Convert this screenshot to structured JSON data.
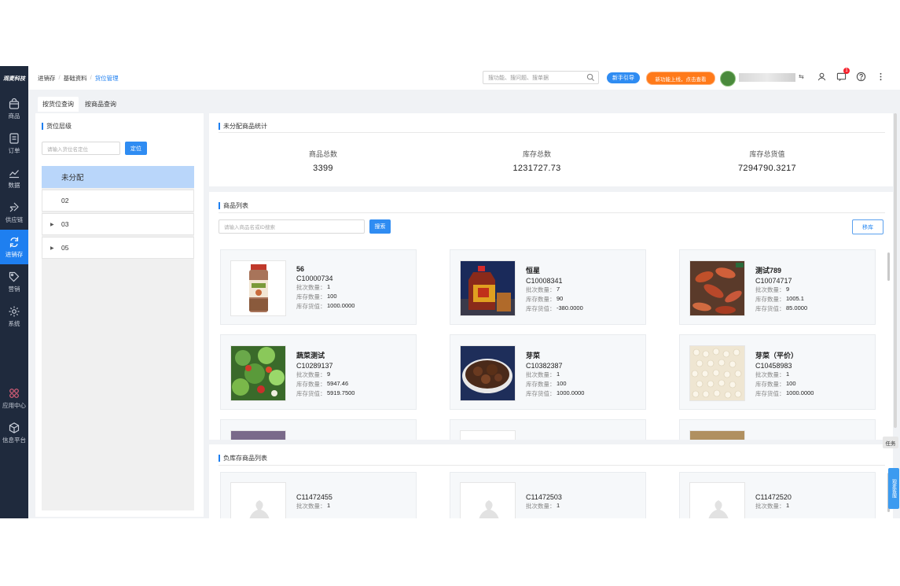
{
  "brand": "观麦科技",
  "sidebar": {
    "items": [
      {
        "label": "商品",
        "icon": "bag-icon"
      },
      {
        "label": "订单",
        "icon": "order-icon"
      },
      {
        "label": "数据",
        "icon": "chart-icon"
      },
      {
        "label": "供应链",
        "icon": "supply-chain-icon"
      },
      {
        "label": "进销存",
        "icon": "inventory-icon",
        "active": true
      },
      {
        "label": "营销",
        "icon": "tag-icon"
      },
      {
        "label": "系统",
        "icon": "gear-icon"
      }
    ],
    "bottom": [
      {
        "label": "应用中心",
        "icon": "app-center-icon"
      },
      {
        "label": "信息平台",
        "icon": "cube-icon"
      }
    ]
  },
  "breadcrumb": [
    "进销存",
    "基础资料",
    "货位管理"
  ],
  "topbar": {
    "search_placeholder": "搜功能、搜问题、搜单据",
    "guide_label": "新手引导",
    "promo_label": "新功能上线，点击查看",
    "notification_count": "1"
  },
  "tabs": [
    "按货位查询",
    "按商品查询"
  ],
  "left": {
    "title": "货位层级",
    "search_placeholder": "请输入货位名定位",
    "locate_label": "定位",
    "tree": [
      {
        "label": "未分配",
        "selected": true,
        "expandable": false
      },
      {
        "label": "02",
        "selected": false,
        "expandable": false
      },
      {
        "label": "03",
        "selected": false,
        "expandable": true
      },
      {
        "label": "05",
        "selected": false,
        "expandable": true
      }
    ]
  },
  "stats": {
    "title": "未分配商品统计",
    "items": [
      {
        "label": "商品总数",
        "value": "3399"
      },
      {
        "label": "库存总数",
        "value": "1231727.73"
      },
      {
        "label": "库存总货值",
        "value": "7294790.3217"
      }
    ]
  },
  "goods": {
    "title": "商品列表",
    "search_placeholder": "请输入商品名或ID搜索",
    "search_label": "搜索",
    "move_label": "移库",
    "labels": {
      "batch": "批次数量：",
      "stock": "库存数量：",
      "value": "库存货值："
    },
    "items": [
      {
        "name": "56",
        "code": "C10000734",
        "batch": "1",
        "stock": "100",
        "value": "1000.0000",
        "image": "spice-jar"
      },
      {
        "name": "恒星",
        "code": "C10008341",
        "batch": "7",
        "stock": "90",
        "value": "-380.0000",
        "image": "oil-bottle"
      },
      {
        "name": "测试789",
        "code": "C10074717",
        "batch": "9",
        "stock": "1005.1",
        "value": "85.0000",
        "image": "crayfish"
      },
      {
        "name": "蔬菜测试",
        "code": "C10289137",
        "batch": "9",
        "stock": "5947.46",
        "value": "5919.7500",
        "image": "salad"
      },
      {
        "name": "芽菜",
        "code": "C10382387",
        "batch": "1",
        "stock": "100",
        "value": "1000.0000",
        "image": "pickled-greens"
      },
      {
        "name": "芽菜（平价）",
        "code": "C10458983",
        "batch": "1",
        "stock": "100",
        "value": "1000.0000",
        "image": "seeds"
      }
    ]
  },
  "negative": {
    "title": "负库存商品列表",
    "items": [
      {
        "code": "C11472455",
        "batch": "1"
      },
      {
        "code": "C11472503",
        "batch": "1"
      },
      {
        "code": "C11472520",
        "batch": "1"
      }
    ]
  },
  "side_tabs": {
    "task": "任务",
    "service": "观麦客服"
  }
}
